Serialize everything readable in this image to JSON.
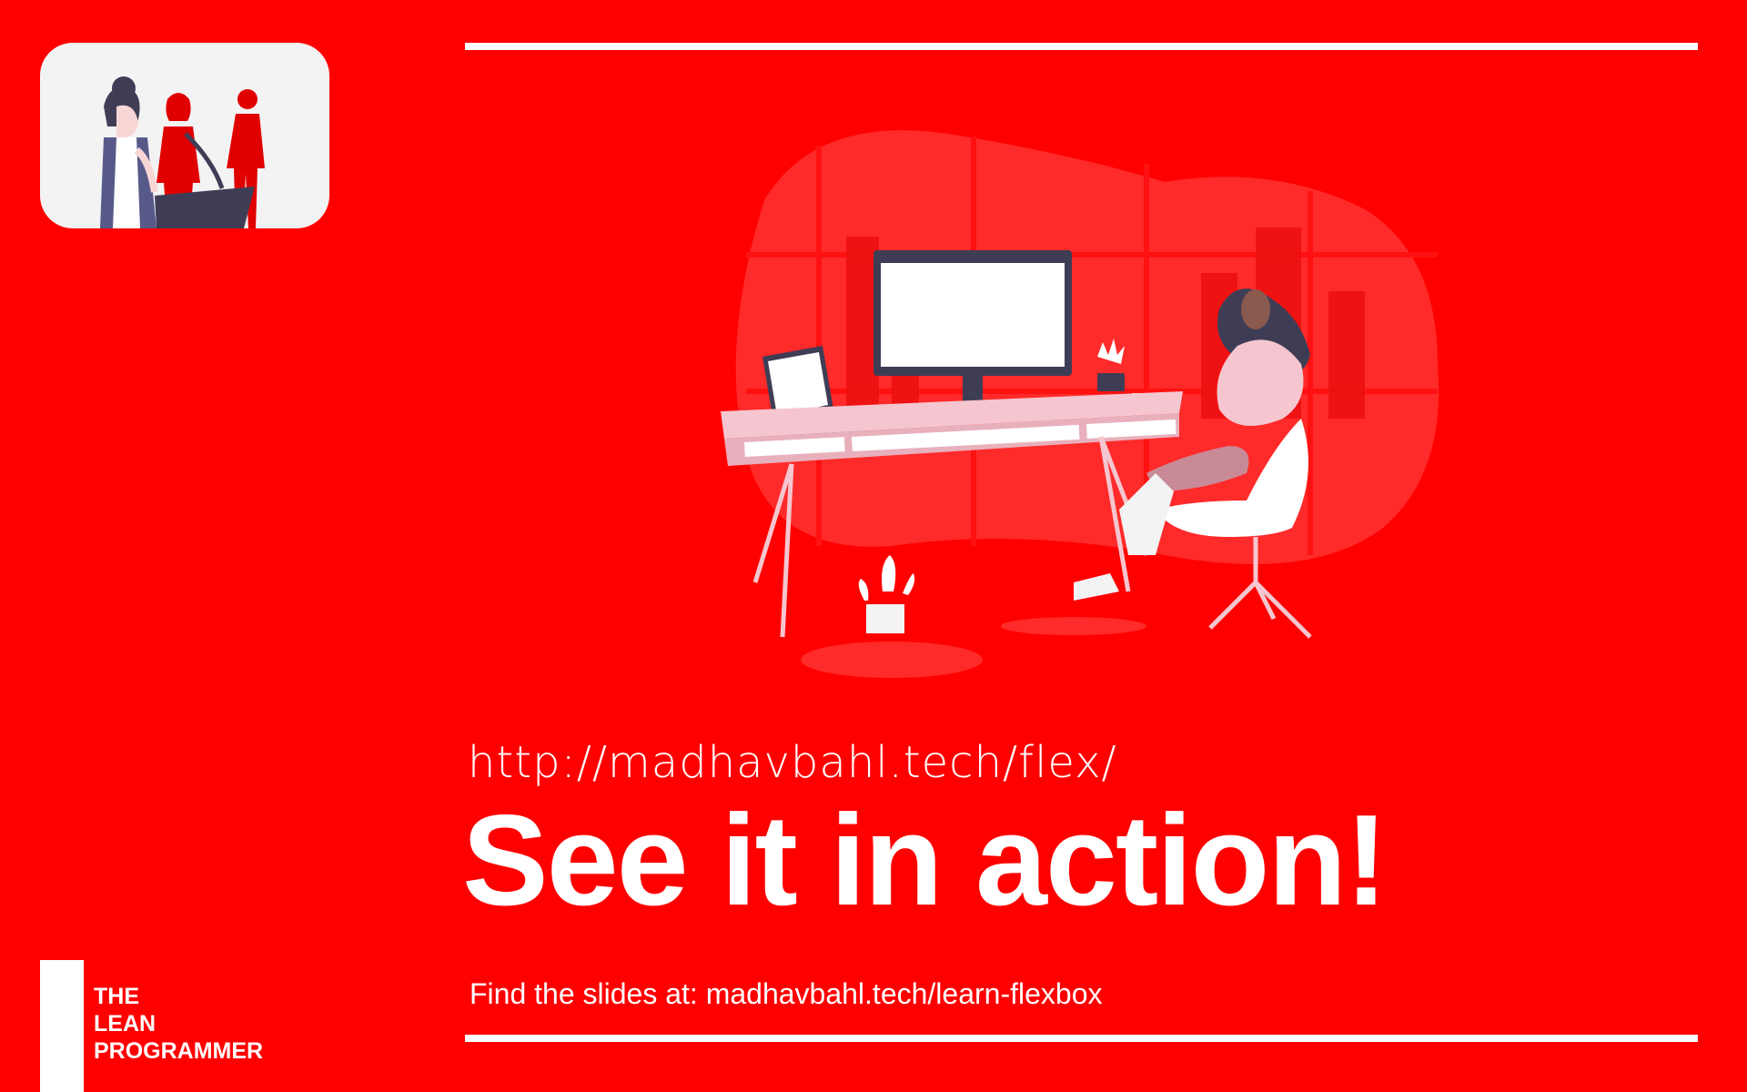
{
  "slide": {
    "url": "http://madhavbahl.tech/flex/",
    "headline": "See it in action!",
    "slides_note": "Find the slides at: madhavbahl.tech/learn-flexbox"
  },
  "brand": {
    "line1": "THE",
    "line2": "LEAN",
    "line3": "PROGRAMMER"
  },
  "colors": {
    "background": "#ff0000",
    "accent_light": "#ffffff",
    "illustration_dark": "#3f3d56",
    "illustration_pink": "#f5c6cf"
  },
  "icons": {
    "logo": "people-at-desk-illustration",
    "hero": "woman-relaxing-at-desk-illustration"
  }
}
